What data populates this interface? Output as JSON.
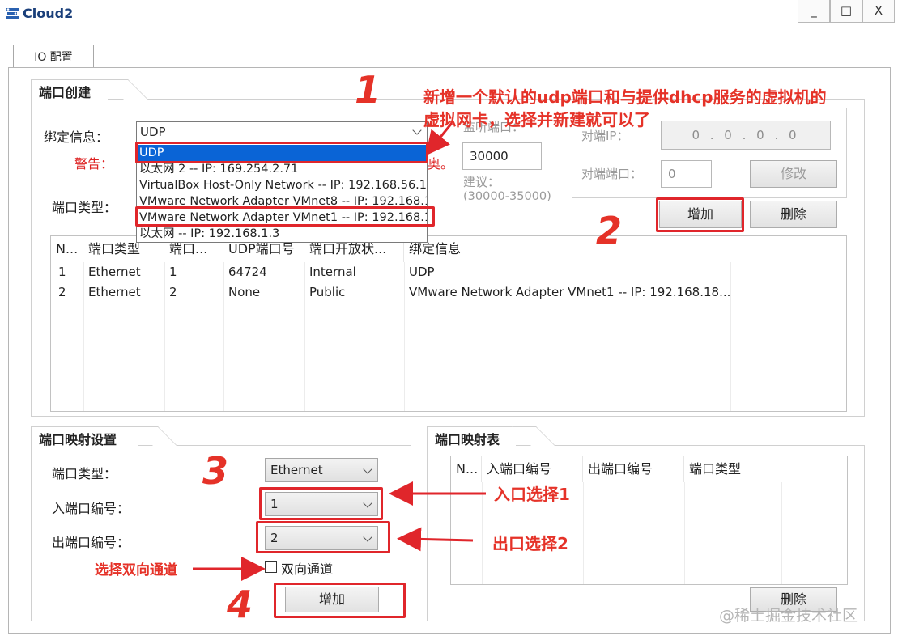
{
  "window": {
    "title": "Cloud2",
    "minimize": "_",
    "maximize": "□",
    "close": "X"
  },
  "tabs": [
    {
      "label": "IO 配置"
    }
  ],
  "port_create": {
    "title": "端口创建",
    "bind_label": "绑定信息：",
    "bind_value": "UDP",
    "warning_label": "警告：",
    "warning_tail": "奥。",
    "port_type_label": "端口类型：",
    "dropdown_options": [
      "UDP",
      "以太网 2 -- IP: 169.254.2.71",
      "VirtualBox Host-Only Network -- IP: 192.168.56.1",
      "VMware Network Adapter VMnet8 -- IP: 192.168.1",
      "VMware Network Adapter VMnet1 -- IP: 192.168.1",
      "以太网 -- IP: 192.168.1.3"
    ],
    "udp_port_label": "监听端口：",
    "udp_port_value": "30000",
    "suggest_label": "建议：",
    "suggest_range": "(30000-35000)",
    "peer_ip_label": "对端IP：",
    "peer_ip_value": "0 . 0 . 0 . 0",
    "peer_port_label": "对端端口：",
    "peer_port_value": "0",
    "modify_button": "修改",
    "add_button": "增加",
    "delete_button": "删除"
  },
  "port_table": {
    "columns": [
      "N...",
      "端口类型",
      "端口...",
      "UDP端口号",
      "端口开放状...",
      "绑定信息"
    ],
    "rows": [
      [
        "1",
        "Ethernet",
        "1",
        "64724",
        "Internal",
        "UDP"
      ],
      [
        "2",
        "Ethernet",
        "2",
        "None",
        "Public",
        "VMware Network Adapter VMnet1 -- IP: 192.168.18..."
      ]
    ]
  },
  "mapping_settings": {
    "title": "端口映射设置",
    "port_type_label": "端口类型：",
    "port_type_value": "Ethernet",
    "in_port_label": "入端口编号：",
    "in_port_value": "1",
    "out_port_label": "出端口编号：",
    "out_port_value": "2",
    "bidirectional_label": "双向通道",
    "add_button": "增加"
  },
  "mapping_table": {
    "title": "端口映射表",
    "columns": [
      "N...",
      "入端口编号",
      "出端口编号",
      "端口类型"
    ],
    "delete_button": "删除"
  },
  "annotations": {
    "n1": "1",
    "n2": "2",
    "n3": "3",
    "n4": "4",
    "note_top_line1": "新增一个默认的udp端口和与提供dhcp服务的虚拟机的",
    "note_top_line2": "虚拟网卡，选择并新建就可以了",
    "note_in": "入口选择1",
    "note_out": "出口选择2",
    "note_bidir": "选择双向通道"
  },
  "watermark": "@稀土掘金技术社区",
  "colors": {
    "annotation_red": "#e0262b",
    "title_blue": "#1a3f7a"
  }
}
